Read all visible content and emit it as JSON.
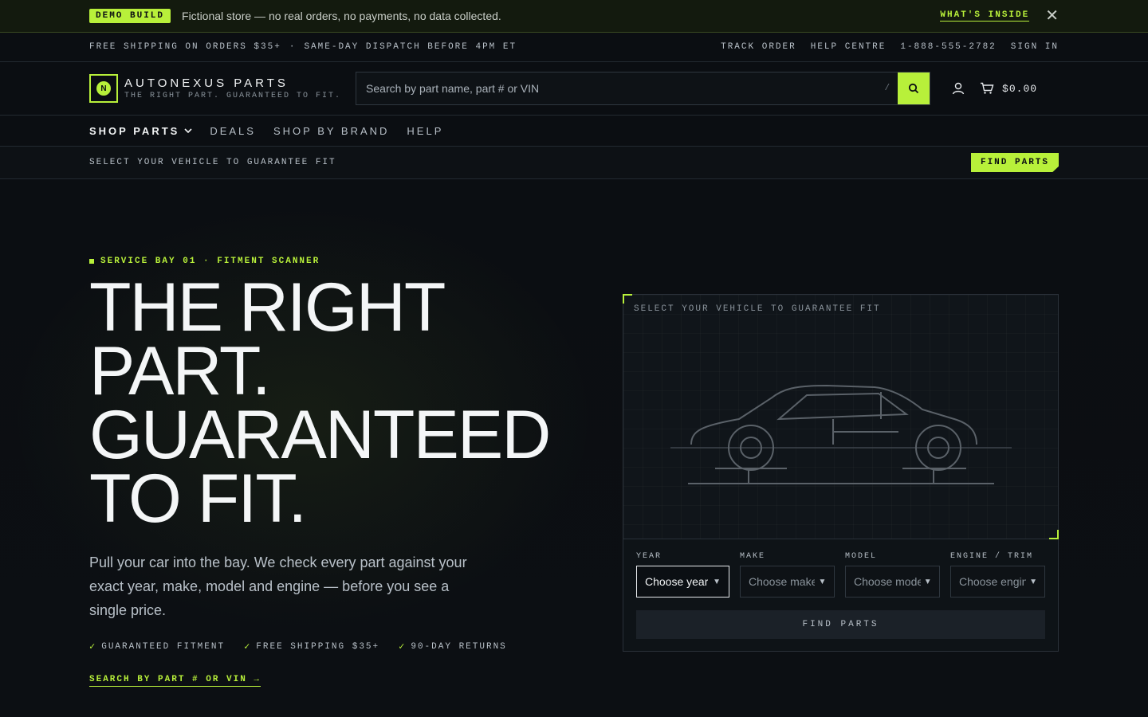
{
  "demo": {
    "badge": "DEMO BUILD",
    "text": "Fictional store — no real orders, no payments, no data collected.",
    "whats_inside": "WHAT'S INSIDE",
    "close": "✕"
  },
  "utility": {
    "shipping": "FREE SHIPPING ON ORDERS $35+",
    "separator": "·",
    "dispatch": "SAME-DAY DISPATCH BEFORE 4PM ET",
    "links": [
      "TRACK ORDER",
      "HELP CENTRE",
      "1-888-555-2782",
      "SIGN IN"
    ]
  },
  "header": {
    "logo_mark": "N",
    "logo_name": "AUTONEXUS PARTS",
    "logo_tag": "THE RIGHT PART. GUARANTEED TO FIT.",
    "search_placeholder": "Search by part name, part # or VIN",
    "search_shortcut": "/",
    "cart_total": "$0.00"
  },
  "nav": {
    "items": [
      "SHOP PARTS",
      "DEALS",
      "SHOP BY BRAND",
      "HELP"
    ]
  },
  "vehicle_strip": {
    "label": "SELECT YOUR VEHICLE TO GUARANTEE FIT",
    "button": "FIND PARTS"
  },
  "hero": {
    "eyebrow": "SERVICE BAY 01 · FITMENT SCANNER",
    "headline": [
      "THE RIGHT",
      "PART.",
      "GUARANTEED",
      "TO FIT."
    ],
    "lede": "Pull your car into the bay. We check every part against your exact year, make, model and engine — before you see a single price.",
    "perks": [
      "GUARANTEED FITMENT",
      "FREE SHIPPING $35+",
      "90-DAY RETURNS"
    ],
    "search_link": "SEARCH BY PART # OR VIN →"
  },
  "scanner": {
    "label": "SELECT YOUR VEHICLE TO GUARANTEE FIT",
    "fields": [
      {
        "label": "YEAR",
        "value": "Choose year"
      },
      {
        "label": "MAKE",
        "value": "Choose make"
      },
      {
        "label": "MODEL",
        "value": "Choose model"
      },
      {
        "label": "ENGINE / TRIM",
        "value": "Choose engine"
      }
    ],
    "button": "FIND PARTS"
  },
  "colors": {
    "accent": "#b8f03a",
    "background": "#0b0e12"
  }
}
